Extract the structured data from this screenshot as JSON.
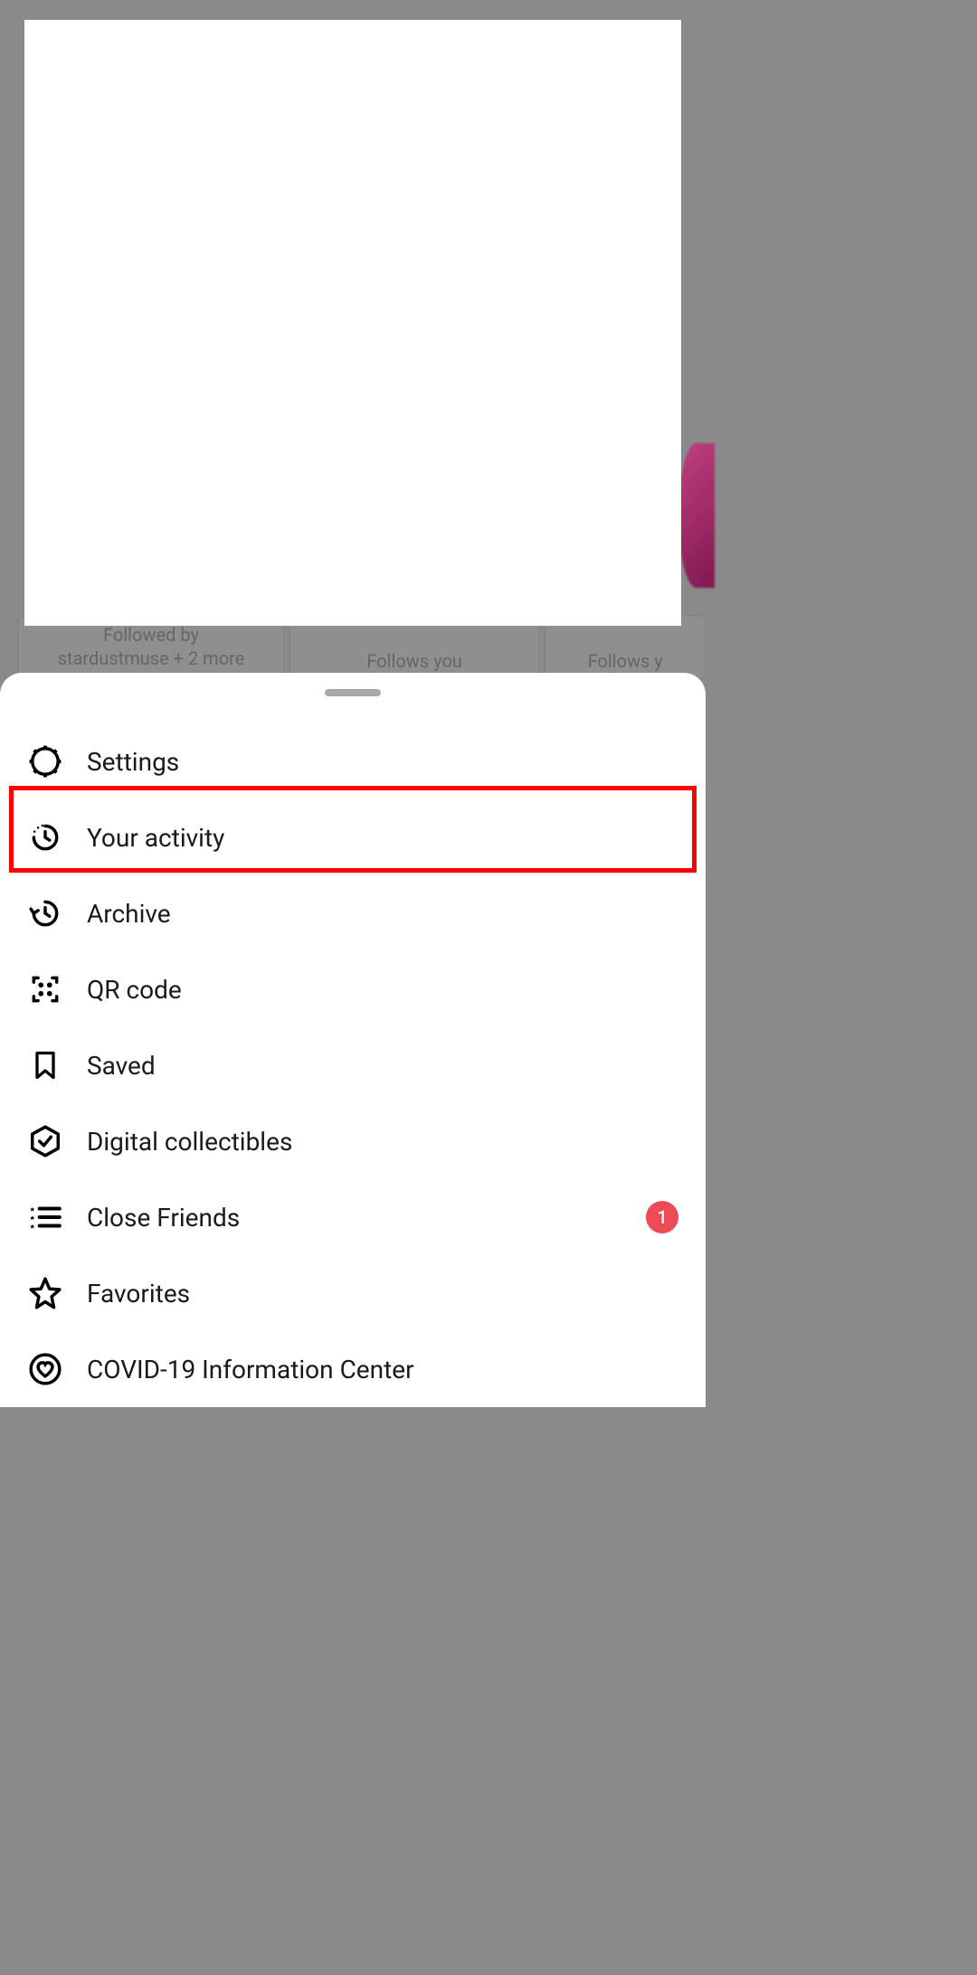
{
  "background": {
    "card1": {
      "line1": "Followed by",
      "line2": "stardustmuse    + 2 more"
    },
    "card2": {
      "text": "Follows you"
    },
    "card3": {
      "text": "Follows y"
    }
  },
  "sheet": {
    "items": [
      {
        "icon": "gear-icon",
        "label": "Settings"
      },
      {
        "icon": "activity-icon",
        "label": "Your activity",
        "highlighted": true
      },
      {
        "icon": "archive-icon",
        "label": "Archive"
      },
      {
        "icon": "qr-icon",
        "label": "QR code"
      },
      {
        "icon": "bookmark-icon",
        "label": "Saved"
      },
      {
        "icon": "hexagon-check-icon",
        "label": "Digital collectibles"
      },
      {
        "icon": "star-list-icon",
        "label": "Close Friends",
        "badge": "1"
      },
      {
        "icon": "star-icon",
        "label": "Favorites"
      },
      {
        "icon": "heart-circle-icon",
        "label": "COVID-19 Information Center"
      }
    ]
  }
}
